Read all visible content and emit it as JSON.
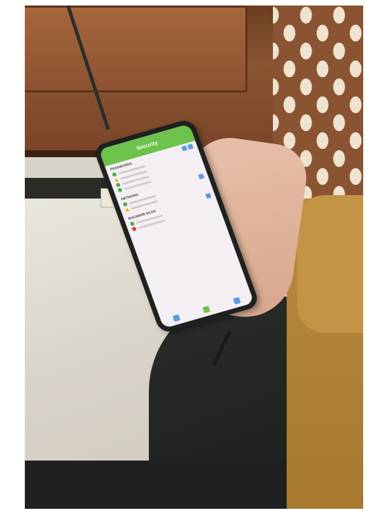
{
  "scene": {
    "description_items": [
      "photo"
    ]
  },
  "app": {
    "title": "Security",
    "colors": {
      "header": "#6cc24a",
      "ok": "#4caf50",
      "warn": "#f2b620",
      "error": "#e53935",
      "accent": "#5a9be6"
    }
  },
  "sections": [
    {
      "heading": "PASSWORDS",
      "items": [
        {
          "status": "ok"
        },
        {
          "status": "warn"
        },
        {
          "status": "ok"
        },
        {
          "status": "ok"
        }
      ]
    },
    {
      "heading": "NETWORK",
      "items": [
        {
          "status": "ok"
        },
        {
          "status": "warn"
        }
      ]
    },
    {
      "heading": "MALWARE SCAN",
      "items": [
        {
          "status": "ok"
        },
        {
          "status": "error"
        }
      ]
    }
  ]
}
